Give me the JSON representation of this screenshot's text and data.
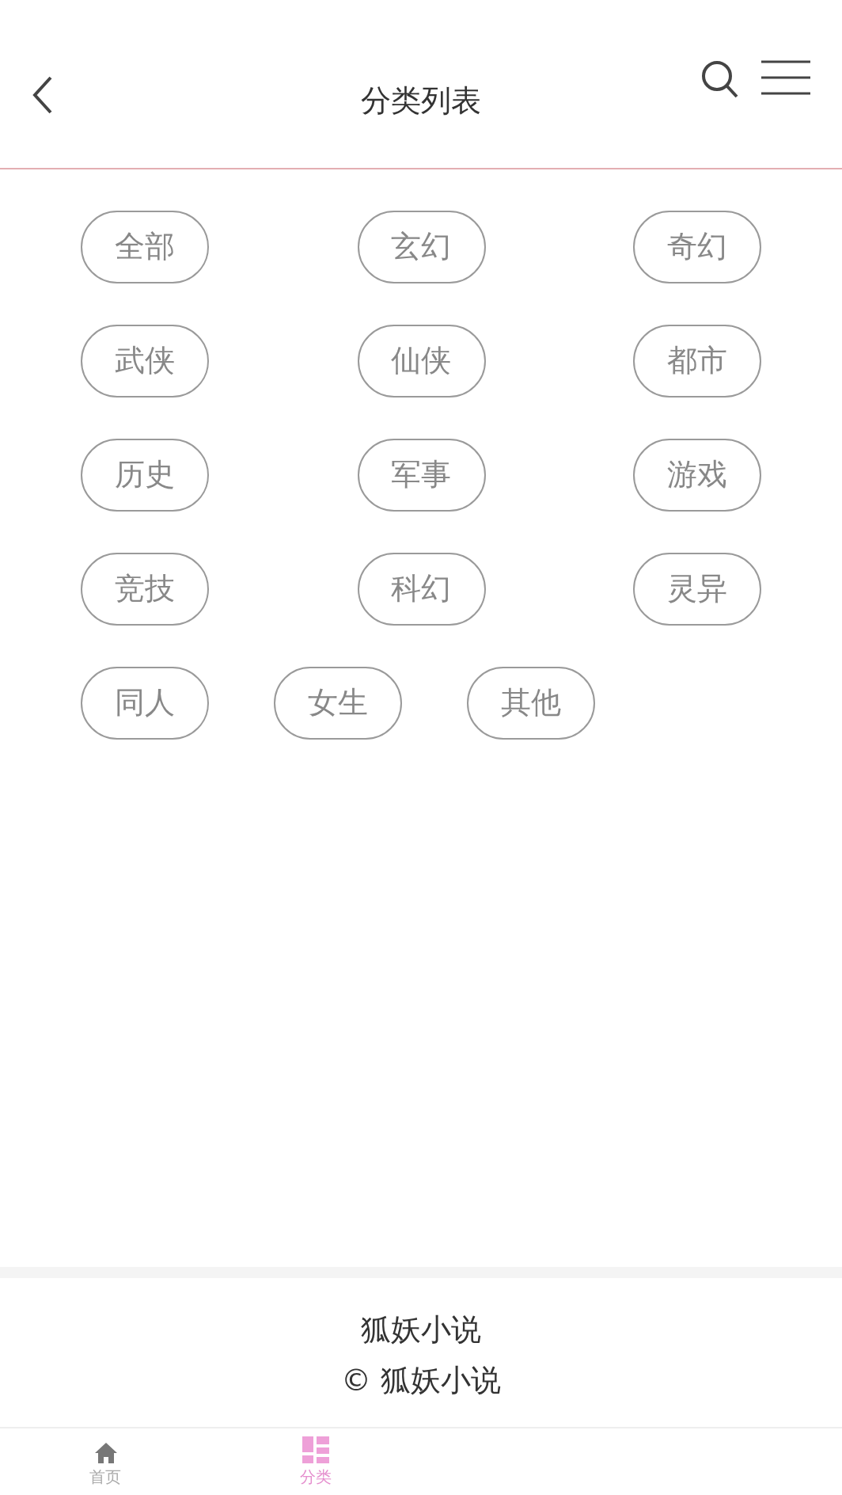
{
  "header": {
    "title": "分类列表"
  },
  "categories": [
    {
      "label": "全部"
    },
    {
      "label": "玄幻"
    },
    {
      "label": "奇幻"
    },
    {
      "label": "武侠"
    },
    {
      "label": "仙侠"
    },
    {
      "label": "都市"
    },
    {
      "label": "历史"
    },
    {
      "label": "军事"
    },
    {
      "label": "游戏"
    },
    {
      "label": "竞技"
    },
    {
      "label": "科幻"
    },
    {
      "label": "灵异"
    },
    {
      "label": "同人"
    },
    {
      "label": "女生"
    },
    {
      "label": "其他"
    }
  ],
  "footer": {
    "site_name": "狐妖小说",
    "copyright": "© 狐妖小说"
  },
  "bottom_nav": [
    {
      "label": "首页",
      "kind": "home",
      "selected": false
    },
    {
      "label": "分类",
      "kind": "category",
      "selected": true
    }
  ]
}
